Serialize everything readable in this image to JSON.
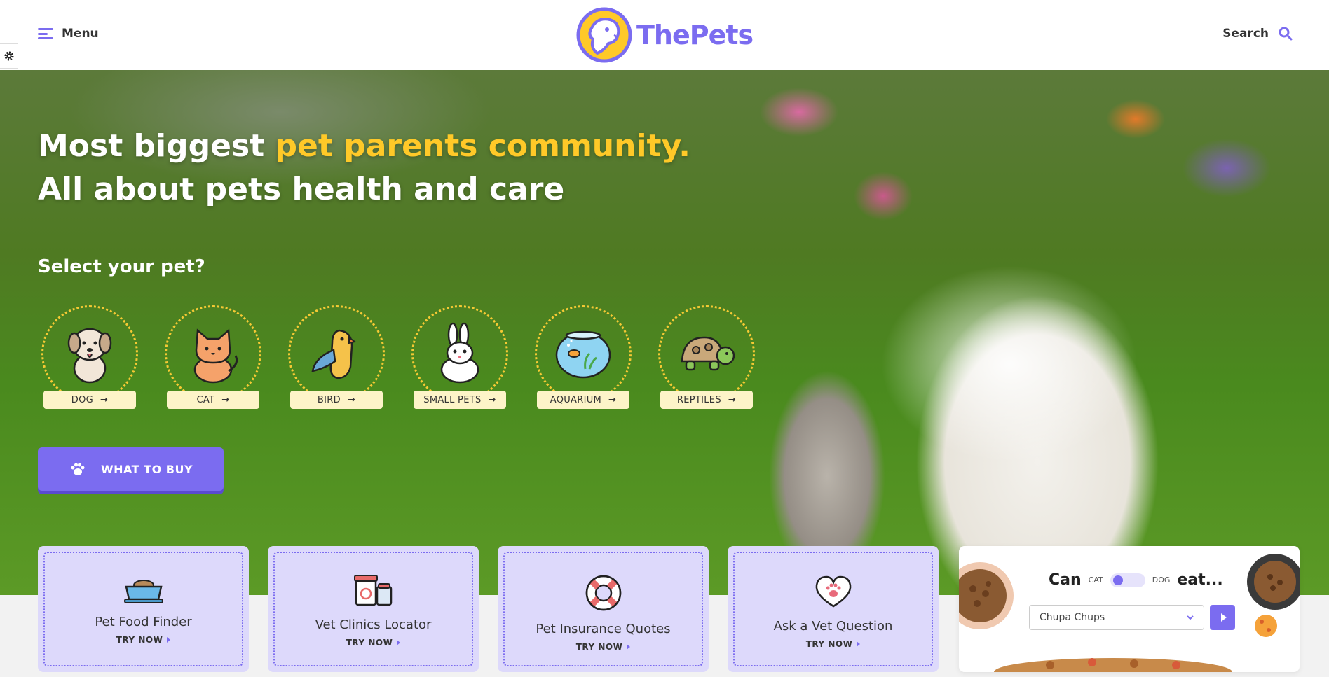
{
  "header": {
    "menu_label": "Menu",
    "logo_text": "ThePets",
    "search_label": "Search"
  },
  "hero": {
    "title_part1": "Most biggest ",
    "title_highlight": "pet parents community.",
    "title_line2": "All about pets health and care",
    "select_label": "Select your pet?",
    "pets": [
      {
        "label": "DOG",
        "icon": "dog-icon"
      },
      {
        "label": "CAT",
        "icon": "cat-icon"
      },
      {
        "label": "BIRD",
        "icon": "bird-icon"
      },
      {
        "label": "SMALL PETS",
        "icon": "rabbit-icon"
      },
      {
        "label": "AQUARIUM",
        "icon": "fishbowl-icon"
      },
      {
        "label": "REPTILES",
        "icon": "turtle-icon"
      }
    ],
    "buy_label": "WHAT TO BUY"
  },
  "cards": [
    {
      "title": "Pet Food Finder",
      "cta": "TRY NOW",
      "icon": "food-bowl-icon"
    },
    {
      "title": "Vet Clinics Locator",
      "cta": "TRY NOW",
      "icon": "medicine-icon"
    },
    {
      "title": "Pet Insurance Quotes",
      "cta": "TRY NOW",
      "icon": "lifebuoy-icon"
    },
    {
      "title": "Ask a Vet Question",
      "cta": "TRY NOW",
      "icon": "heart-paw-icon"
    }
  ],
  "eat_widget": {
    "can_label": "Can",
    "cat_label": "CAT",
    "dog_label": "DOG",
    "eat_label": "eat...",
    "selected_food": "Chupa Chups"
  },
  "colors": {
    "accent": "#7b6cf0",
    "highlight": "#ffc928",
    "tag_bg": "#fdf4c8",
    "card_bg": "#ddd9fb"
  }
}
